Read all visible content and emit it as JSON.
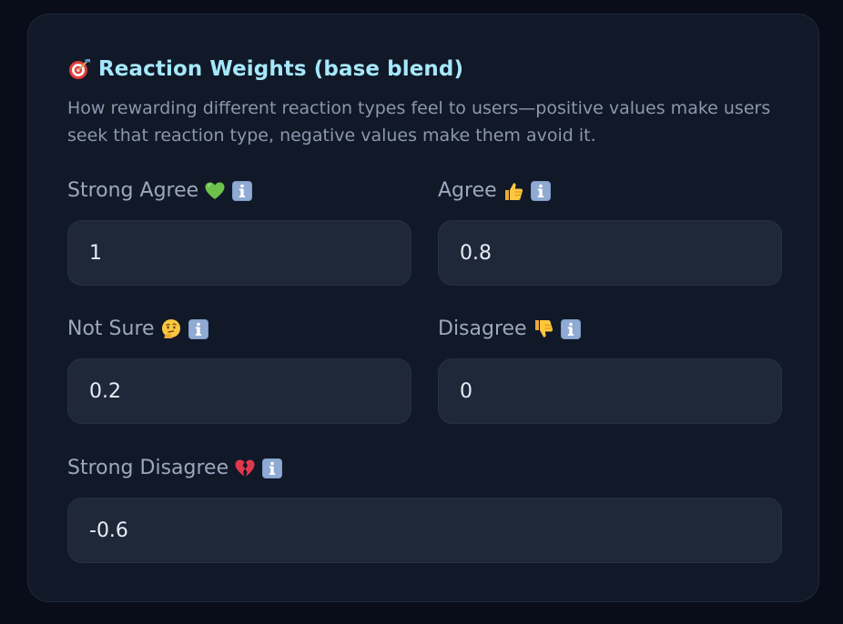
{
  "section": {
    "title_icon": "target-icon",
    "title": "Reaction Weights (base blend)",
    "description": "How rewarding different reaction types feel to users—positive values make users seek that reaction type, negative values make them avoid it."
  },
  "fields": {
    "strong_agree": {
      "label": "Strong Agree",
      "emoji": "green-heart-icon",
      "info_icon": "info-icon",
      "value": "1"
    },
    "agree": {
      "label": "Agree",
      "emoji": "thumbs-up-icon",
      "info_icon": "info-icon",
      "value": "0.8"
    },
    "not_sure": {
      "label": "Not Sure",
      "emoji": "thinking-face-icon",
      "info_icon": "info-icon",
      "value": "0.2"
    },
    "disagree": {
      "label": "Disagree",
      "emoji": "thumbs-down-icon",
      "info_icon": "info-icon",
      "value": "0"
    },
    "strong_disagree": {
      "label": "Strong Disagree",
      "emoji": "broken-heart-icon",
      "info_icon": "info-icon",
      "value": "-0.6"
    }
  },
  "colors": {
    "page_background": "#080d19",
    "card_background": "#111827",
    "title": "#a5e8fb",
    "label": "#9ba8bd",
    "input_background": "#1f2838",
    "input_text": "#e6edf6"
  }
}
